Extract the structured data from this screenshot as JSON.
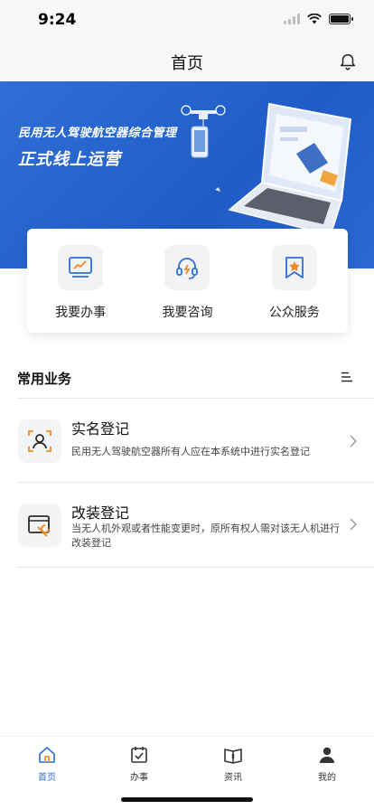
{
  "status_bar": {
    "time": "9:24"
  },
  "nav": {
    "title": "首页"
  },
  "banner": {
    "title": "民用无人驾驶航空器综合管理",
    "subtitle": "正式线上运营"
  },
  "quick_actions": [
    {
      "label": "我要办事",
      "icon": "chart-monitor-icon"
    },
    {
      "label": "我要咨询",
      "icon": "headset-icon"
    },
    {
      "label": "公众服务",
      "icon": "star-bookmark-icon"
    }
  ],
  "section": {
    "title": "常用业务"
  },
  "business_items": [
    {
      "title": "实名登记",
      "description": "民用无人驾驶航空器所有人应在本系统中进行实名登记",
      "icon": "person-scan-icon"
    },
    {
      "title": "改装登记",
      "description": "当无人机外观或者性能变更时，原所有权人需对该无人机进行改装登记",
      "icon": "wrench-window-icon"
    }
  ],
  "tabs": [
    {
      "label": "首页",
      "icon": "home-icon",
      "active": true
    },
    {
      "label": "办事",
      "icon": "task-check-icon",
      "active": false
    },
    {
      "label": "资讯",
      "icon": "book-icon",
      "active": false
    },
    {
      "label": "我的",
      "icon": "user-icon",
      "active": false
    }
  ],
  "colors": {
    "brand": "#2f6fd6",
    "accent": "#f08a24"
  }
}
